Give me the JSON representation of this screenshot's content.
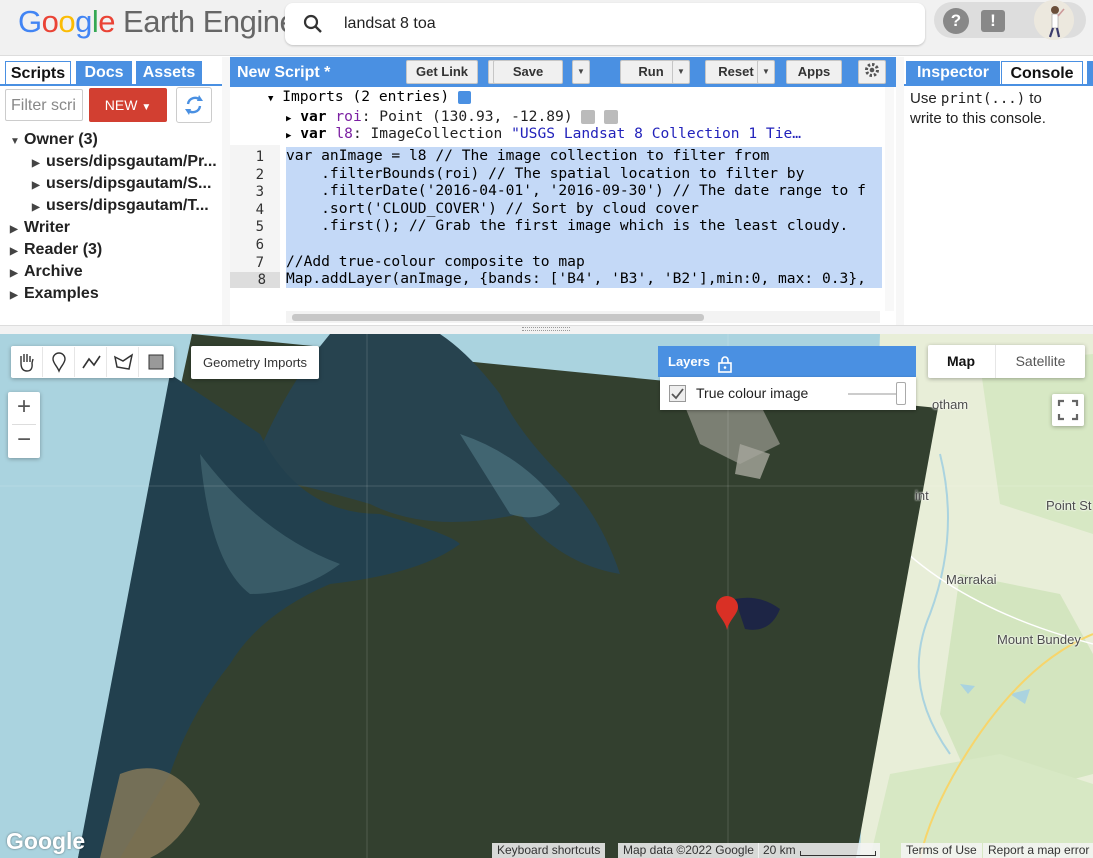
{
  "header": {
    "logo_google_letters": [
      "G",
      "o",
      "o",
      "g",
      "l",
      "e"
    ],
    "logo_suffix": "Earth Engine",
    "search": {
      "value": "landsat 8 toa"
    },
    "help_glyph": "?",
    "feedback_glyph": "!"
  },
  "left_panel": {
    "tabs": [
      "Scripts",
      "Docs",
      "Assets"
    ],
    "filter_placeholder": "Filter scri",
    "new_button": "NEW",
    "tree": [
      {
        "label": "Owner (3)",
        "expanded": true
      },
      {
        "label": "users/dipsgautam/Pr...",
        "child": true
      },
      {
        "label": "users/dipsgautam/S...",
        "child": true
      },
      {
        "label": "users/dipsgautam/T...",
        "child": true
      },
      {
        "label": "Writer"
      },
      {
        "label": "Reader (3)"
      },
      {
        "label": "Archive"
      },
      {
        "label": "Examples"
      }
    ]
  },
  "editor": {
    "title": "New Script *",
    "buttons": [
      "Get Link",
      "Save",
      "Run",
      "Reset",
      "Apps"
    ],
    "imports_header": "Imports (2 entries)",
    "import_lines": [
      {
        "kw": "var",
        "name": "roi",
        "rest": ": Point (130.93, -12.89)"
      },
      {
        "kw": "var",
        "name": "l8",
        "type": ": ImageCollection ",
        "str": "\"USGS Landsat 8 Collection 1 Tie…"
      }
    ],
    "line_numbers": [
      "1",
      "2",
      "3",
      "4",
      "5",
      "6",
      "7",
      "8"
    ],
    "code_lines": [
      "var anImage = l8 // The image collection to filter from",
      "    .filterBounds(roi) // The spatial location to filter by",
      "    .filterDate('2016-04-01', '2016-09-30') // The date range to f",
      "    .sort('CLOUD_COVER') // Sort by cloud cover",
      "    .first(); // Grab the first image which is the least cloudy.",
      "",
      "//Add true-colour composite to map",
      "Map.addLayer(anImage, {bands: ['B4', 'B3', 'B2'],min:0, max: 0.3},"
    ]
  },
  "right_panel": {
    "tabs": [
      "Inspector",
      "Console"
    ],
    "console_text_pre": "Use ",
    "console_code": "print(...)",
    "console_text_post": " to",
    "console_text_line2": "write to this console."
  },
  "map": {
    "geometry_imports_label": "Geometry Imports",
    "layers_title": "Layers",
    "layer_name": "True colour image",
    "layer_visible": true,
    "map_type_buttons": [
      "Map",
      "Satellite"
    ],
    "map_type_selected": "Map",
    "zoom_in": "+",
    "zoom_out": "−",
    "place_labels": [
      "otham",
      "int",
      "Point St",
      "Marrakai",
      "Mount Bundey"
    ],
    "google_watermark": "Google",
    "footer": {
      "shortcuts": "Keyboard shortcuts",
      "attribution": "Map data ©2022 Google",
      "scale": "20 km",
      "terms": "Terms of Use",
      "report": "Report a map error"
    },
    "colors": {
      "water": "#aad3df",
      "land": "#e8eed8",
      "accent": "#4a90e2",
      "marker": "#d93025"
    }
  }
}
